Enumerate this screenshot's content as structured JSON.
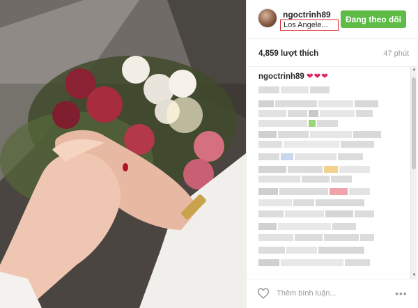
{
  "post": {
    "username": "ngoctrinh89",
    "location": "Los Angele...",
    "follow_label": "Đang theo dõi",
    "likes": "4,859 lượt thích",
    "time": "47 phút",
    "caption_user": "ngoctrinh89",
    "caption_hearts": "❤❤❤",
    "comment_placeholder": "Thêm bình luận...",
    "more_label": "•••"
  },
  "colors": {
    "follow_button": "#5dbb46",
    "location_highlight": "#d8232a",
    "hearts": "#e0245e"
  },
  "icons": {
    "like": "heart-outline-icon",
    "more": "more-dots-icon",
    "avatar": "profile-avatar"
  }
}
